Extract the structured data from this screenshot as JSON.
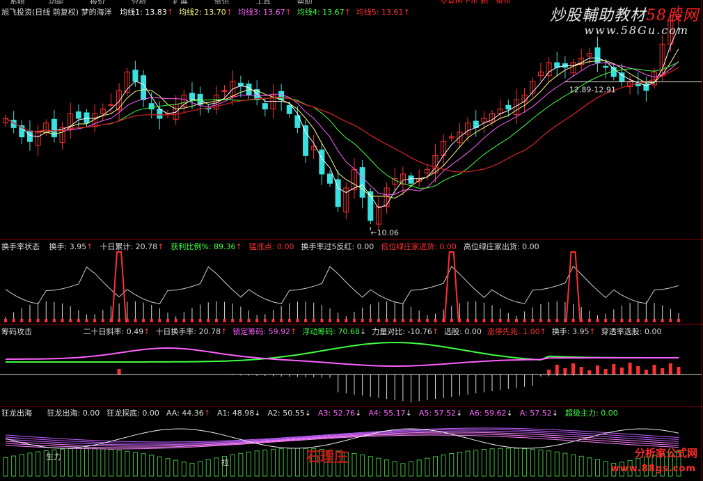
{
  "colors": {
    "bg": "#000000",
    "up": "#ff3030",
    "down": "#39e0e0",
    "ma1": "#ffffff",
    "ma2": "#ffff80",
    "ma3": "#ff60ff",
    "ma4": "#40ff40",
    "ma5": "#c02020",
    "separator": "#8b0000"
  },
  "menu": {
    "items": [
      "系统",
      "功能",
      "报价",
      "分析",
      "扩展",
      "资讯",
      "工具",
      "帮助"
    ]
  },
  "top_right_text": "交易所上市 超.. 资讯",
  "watermarks": {
    "site1_prefix": "炒股輔助教材",
    "site1_suffix": "58股网",
    "site1_url": "www.58Gu.com",
    "site2_name": "分析家公式网",
    "site2_url": "www.88gs.com",
    "center_logo": "石理庄"
  },
  "panel1": {
    "title": "旭飞投资(日线 前复权) 梦的海洋",
    "indicators": [
      {
        "label": "均线1:",
        "value": "13.83",
        "arrow": "↑",
        "color": "#ffffff"
      },
      {
        "label": "均线2:",
        "value": "13.70",
        "arrow": "↑",
        "color": "#ffff80"
      },
      {
        "label": "均线3:",
        "value": "13.67",
        "arrow": "↑",
        "color": "#ff60ff"
      },
      {
        "label": "均线4:",
        "value": "13.67",
        "arrow": "↑",
        "color": "#40ff40"
      },
      {
        "label": "均线5:",
        "value": "13.61",
        "arrow": "↑",
        "color": "#ff3030"
      }
    ],
    "price_low_label": "←10.06",
    "range_label": "12.89-12.91"
  },
  "panel2": {
    "title": "换手率状态",
    "items": [
      {
        "label": "换手:",
        "value": "3.95",
        "arrow": "↑",
        "color": "#dddddd"
      },
      {
        "label": "十日累计:",
        "value": "20.78",
        "arrow": "↑",
        "color": "#dddddd"
      },
      {
        "label": "获利比例%:",
        "value": "89.36",
        "arrow": "↑",
        "color": "#40ff40"
      },
      {
        "label": "猛涨点:",
        "value": "0.00",
        "arrow": "",
        "color": "#ff3030"
      },
      {
        "label": "换手率过5反红:",
        "value": "0.00",
        "arrow": "",
        "color": "#dddddd"
      },
      {
        "label": "低位绿庄家进货:",
        "value": "0.00",
        "arrow": "",
        "color": "#ff3030"
      },
      {
        "label": "高位绿庄家出货:",
        "value": "0.00",
        "arrow": "",
        "color": "#dddddd"
      }
    ]
  },
  "panel3": {
    "title": "筹码攻击",
    "items": [
      {
        "label": "二十日斜率:",
        "value": "0.49",
        "arrow": "↑",
        "color": "#dddddd"
      },
      {
        "label": "十日换手率:",
        "value": "20.78",
        "arrow": "↑",
        "color": "#dddddd"
      },
      {
        "label": "锁定筹码:",
        "value": "59.92",
        "arrow": "↑",
        "color": "#ff60ff"
      },
      {
        "label": "浮动筹码:",
        "value": "70.68",
        "arrow": "↓",
        "color": "#40ff40"
      },
      {
        "label": "力量对比:",
        "value": "-10.76",
        "arrow": "↑",
        "color": "#dddddd"
      },
      {
        "label": "选股:",
        "value": "0.00",
        "arrow": "",
        "color": "#dddddd"
      },
      {
        "label": "涨停先兆:",
        "value": "1.00",
        "arrow": "↑",
        "color": "#ff3030"
      },
      {
        "label": "换手:",
        "value": "3.95",
        "arrow": "↑",
        "color": "#dddddd"
      },
      {
        "label": "穿透率选股:",
        "value": "0.00",
        "arrow": "",
        "color": "#dddddd"
      }
    ]
  },
  "panel4": {
    "title": "狂龙出海",
    "items": [
      {
        "label": "狂龙出海:",
        "value": "0.00",
        "arrow": "",
        "color": "#dddddd"
      },
      {
        "label": "狂龙探底:",
        "value": "0.00",
        "arrow": "",
        "color": "#dddddd"
      },
      {
        "label": "AA:",
        "value": "44.36",
        "arrow": "↑",
        "color": "#dddddd"
      },
      {
        "label": "A1:",
        "value": "48.98",
        "arrow": "↓",
        "color": "#dddddd"
      },
      {
        "label": "A2:",
        "value": "50.55",
        "arrow": "↓",
        "color": "#dddddd"
      },
      {
        "label": "A3:",
        "value": "52.76",
        "arrow": "↓",
        "color": "#ff60ff"
      },
      {
        "label": "A4:",
        "value": "55.17",
        "arrow": "↓",
        "color": "#ff60ff"
      },
      {
        "label": "A5:",
        "value": "57.52",
        "arrow": "↓",
        "color": "#ff60ff"
      },
      {
        "label": "A6:",
        "value": "59.62",
        "arrow": "↓",
        "color": "#ff60ff"
      },
      {
        "label": "A:",
        "value": "57.52",
        "arrow": "↓",
        "color": "#ff60ff"
      },
      {
        "label": "超级主力:",
        "value": "0.00",
        "arrow": "",
        "color": "#40ff40"
      }
    ],
    "marker_labels": [
      "生力",
      "拉"
    ]
  },
  "chart_data": {
    "type": "candlestick",
    "ylim": [
      10.0,
      14.5
    ],
    "bars": 84,
    "close": [
      12.4,
      12.2,
      12.0,
      11.9,
      12.1,
      12.3,
      12.0,
      12.2,
      12.5,
      12.4,
      12.3,
      12.5,
      12.6,
      12.7,
      13.0,
      13.4,
      13.2,
      12.8,
      12.6,
      12.4,
      12.5,
      12.7,
      12.9,
      12.8,
      12.7,
      12.6,
      12.9,
      13.0,
      13.2,
      13.1,
      12.9,
      12.8,
      12.6,
      12.9,
      12.8,
      12.5,
      12.2,
      11.6,
      11.8,
      11.2,
      11.0,
      10.5,
      10.9,
      11.3,
      10.7,
      10.2,
      10.5,
      10.9,
      11.1,
      11.2,
      11.0,
      11.1,
      11.3,
      11.6,
      11.9,
      12.0,
      12.1,
      12.3,
      12.2,
      12.4,
      12.5,
      12.6,
      12.6,
      12.8,
      12.9,
      13.2,
      13.4,
      13.6,
      13.5,
      13.5,
      13.6,
      13.7,
      13.8,
      13.6,
      13.5,
      13.3,
      13.2,
      13.2,
      13.1,
      13.0,
      13.4,
      14.0,
      14.5,
      14.6
    ],
    "turnover_peaks": [
      14,
      55,
      70
    ],
    "ma_values": {
      "MA1": 13.83,
      "MA2": 13.7,
      "MA3": 13.67,
      "MA4": 13.67,
      "MA5": 13.61
    },
    "low_point": 10.06
  }
}
